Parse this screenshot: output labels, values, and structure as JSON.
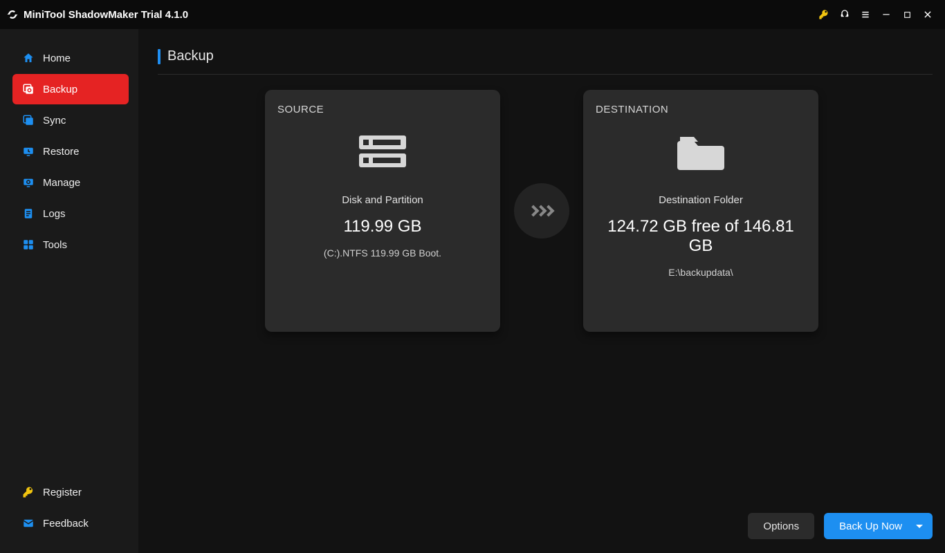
{
  "title": "MiniTool ShadowMaker Trial 4.1.0",
  "sidebar": {
    "items": [
      {
        "key": "home",
        "label": "Home"
      },
      {
        "key": "backup",
        "label": "Backup"
      },
      {
        "key": "sync",
        "label": "Sync"
      },
      {
        "key": "restore",
        "label": "Restore"
      },
      {
        "key": "manage",
        "label": "Manage"
      },
      {
        "key": "logs",
        "label": "Logs"
      },
      {
        "key": "tools",
        "label": "Tools"
      }
    ],
    "active": "backup",
    "bottom": [
      {
        "key": "register",
        "label": "Register"
      },
      {
        "key": "feedback",
        "label": "Feedback"
      }
    ]
  },
  "page": {
    "title": "Backup"
  },
  "source": {
    "label": "SOURCE",
    "title": "Disk and Partition",
    "size": "119.99 GB",
    "detail": "(C:).NTFS 119.99 GB Boot."
  },
  "destination": {
    "label": "DESTINATION",
    "title": "Destination Folder",
    "space": "124.72 GB free of 146.81 GB",
    "path": "E:\\backupdata\\"
  },
  "buttons": {
    "options": "Options",
    "backup_now": "Back Up Now"
  },
  "colors": {
    "accent_red": "#e52323",
    "accent_blue": "#1d8ff1",
    "accent_key": "#f1c40f"
  }
}
